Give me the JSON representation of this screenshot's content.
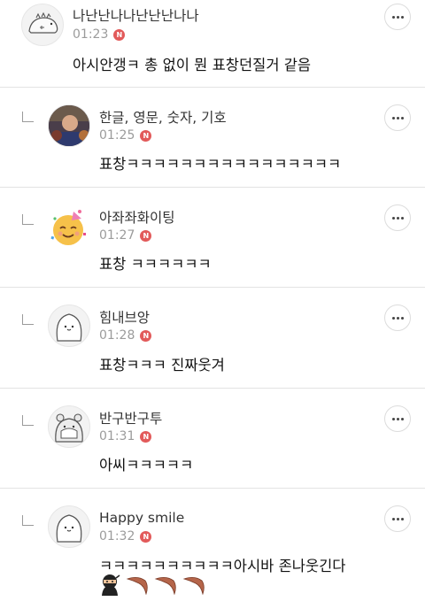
{
  "comments": [
    {
      "nickname": "나난난나나난난난나나",
      "time": "01:23",
      "badge": "N",
      "text": "아시안갱ㅋ 총 없이 뭔 표창던질거 같음",
      "avatar_icon": "dino-avatar-icon",
      "is_reply": false
    },
    {
      "nickname": "한글, 영문, 숫자, 기호",
      "time": "01:25",
      "badge": "N",
      "text": "표창ㅋㅋㅋㅋㅋㅋㅋㅋㅋㅋㅋㅋㅋㅋㅋㅋ",
      "avatar_icon": "photo-avatar-icon",
      "is_reply": true
    },
    {
      "nickname": "아좌좌화이팅",
      "time": "01:27",
      "badge": "N",
      "text": "표창 ㅋㅋㅋㅋㅋㅋ",
      "avatar_icon": "party-face-icon",
      "is_reply": true
    },
    {
      "nickname": "힘내브앙",
      "time": "01:28",
      "badge": "N",
      "text": "표창ㅋㅋㅋ 진짜웃겨",
      "avatar_icon": "blob-avatar-icon",
      "is_reply": true
    },
    {
      "nickname": "반구반구투",
      "time": "01:31",
      "badge": "N",
      "text": "아씨ㅋㅋㅋㅋㅋ",
      "avatar_icon": "hamster-avatar-icon",
      "is_reply": true
    },
    {
      "nickname": "Happy smile",
      "time": "01:32",
      "badge": "N",
      "text": "ㅋㅋㅋㅋㅋㅋㅋㅋㅋㅋ아시바 존나웃긴다",
      "avatar_icon": "blob-avatar-icon",
      "is_reply": true,
      "emojis": [
        "ninja-icon",
        "boomerang-icon",
        "boomerang-icon",
        "boomerang-icon"
      ]
    }
  ],
  "colors": {
    "badge": "#e25a5a",
    "time": "#9b9b9b",
    "divider": "#e3e3e3"
  }
}
